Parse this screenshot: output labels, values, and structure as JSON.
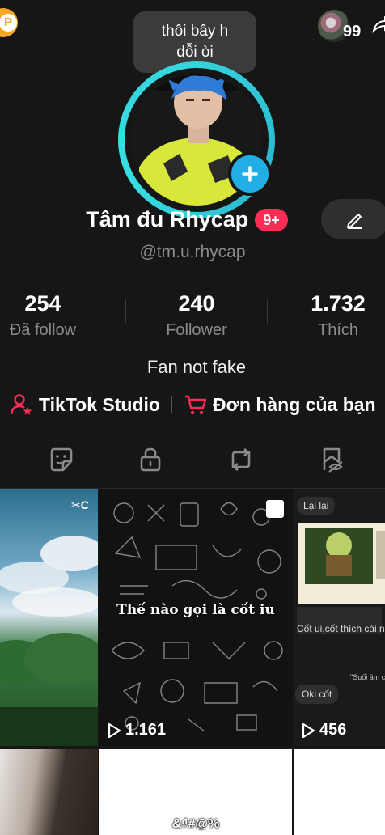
{
  "bubble": {
    "line1": "thôi bây h",
    "line2": "dỗi òi"
  },
  "friends": {
    "count": "99"
  },
  "profile": {
    "name": "Tâm đu Rhycap",
    "badge": "9+",
    "handle": "@tm.u.rhycap",
    "bio": "Fan not fake"
  },
  "stats": [
    {
      "value": "254",
      "label": "Đã follow"
    },
    {
      "value": "240",
      "label": "Follower"
    },
    {
      "value": "1.732",
      "label": "Thích"
    }
  ],
  "links": {
    "studio": "TikTok Studio",
    "orders": "Đơn hàng của bạn"
  },
  "videos": [
    {
      "views": "",
      "caption": ""
    },
    {
      "views": "1.161",
      "caption": "Thế nào gọi là cốt iu"
    },
    {
      "views": "456",
      "caption": "",
      "chat1": "Lại lại",
      "chat2": "Cốt ui,cốt thích cái n",
      "chat3": "Oki cốt",
      "chat4": "\"Suối âm c"
    },
    {
      "views": "",
      "caption": ""
    },
    {
      "views": "",
      "caption": "&₫#@%"
    },
    {
      "views": "",
      "caption": ""
    }
  ],
  "colors": {
    "accent": "#fe2c55",
    "ring": "#35d3dc",
    "plus": "#20aee4"
  }
}
